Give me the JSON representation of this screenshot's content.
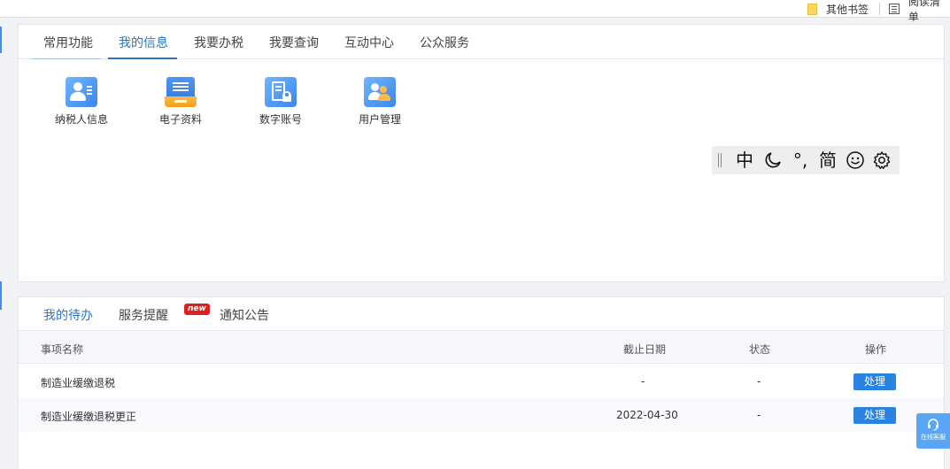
{
  "browser": {
    "bookmarks": [
      {
        "label": "其他书签",
        "icon": "folder-icon"
      },
      {
        "label": "阅读清单",
        "icon": "reading-list-icon"
      }
    ]
  },
  "top_panel": {
    "tabs": [
      {
        "label": "常用功能",
        "active": false
      },
      {
        "label": "我的信息",
        "active": true
      },
      {
        "label": "我要办税",
        "active": false
      },
      {
        "label": "我要查询",
        "active": false
      },
      {
        "label": "互动中心",
        "active": false
      },
      {
        "label": "公众服务",
        "active": false
      }
    ],
    "functions": [
      {
        "label": "纳税人信息",
        "icon": "taxpayer-info-icon"
      },
      {
        "label": "电子资料",
        "icon": "electronic-docs-icon"
      },
      {
        "label": "数字账号",
        "icon": "digital-account-icon"
      },
      {
        "label": "用户管理",
        "icon": "user-management-icon"
      }
    ]
  },
  "ime_toolbar": {
    "chinese": "中",
    "punct": "°,",
    "simplified": "简",
    "icons": [
      "moon-icon",
      "smile-icon",
      "gear-icon"
    ]
  },
  "bottom_panel": {
    "tabs": [
      {
        "label": "我的待办",
        "active": true
      },
      {
        "label": "服务提醒",
        "active": false,
        "badge": "new"
      },
      {
        "label": "通知公告",
        "active": false
      }
    ],
    "table": {
      "headers": [
        "事项名称",
        "截止日期",
        "状态",
        "操作"
      ],
      "rows": [
        {
          "name": "制造业缓缴退税",
          "deadline": "-",
          "status": "-",
          "action": "处理"
        },
        {
          "name": "制造业缓缴退税更正",
          "deadline": "2022-04-30",
          "status": "-",
          "action": "处理"
        }
      ]
    }
  },
  "online_service": {
    "label": "在线客服",
    "icon": "headset-icon"
  },
  "colors": {
    "accent": "#2b74c8",
    "button": "#2b83e0",
    "badge": "#e02020",
    "float": "#5aa6f6"
  }
}
